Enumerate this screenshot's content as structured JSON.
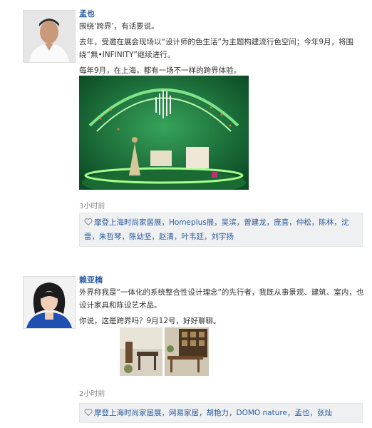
{
  "posts": [
    {
      "author": "孟也",
      "paragraphs": [
        "围绕‘跨界’，有话要说。",
        "去年，受邀在展会现场以“设计师的色生活”为主题构建流行色空间；今年9月，将围绕“無•INFINITY”继续进行。",
        "每年9月，在上海，都有一场不一样的跨界体验。"
      ],
      "time": "3小时前",
      "tags": [
        "摩登上海时尚家居展",
        "Homeplus展",
        "吴滨",
        "曾建龙",
        "庞喜",
        "仲松",
        "陈林",
        "沈雷",
        "朱哲琴",
        "陈幼坚",
        "赵清",
        "叶韦廷",
        "刘宇扬"
      ]
    },
    {
      "author": "赖亚楠",
      "paragraphs": [
        "外界称我是“一体化的系统整合性设计理念”的先行者，我既从事景观、建筑、室内，也设计家具和陈设艺术品。",
        "你说，这是跨界吗？9月12号，好好聊聊。"
      ],
      "time": "2小时前",
      "tags": [
        "摩登上海时尚家居展",
        "网易家居",
        "胡艳力",
        "DOMO nature",
        "孟也",
        "张灿"
      ]
    }
  ],
  "colors": {
    "link": "#2a5a9e",
    "tagbox_bg": "#eef0f2",
    "green": "#1f7a3a"
  }
}
